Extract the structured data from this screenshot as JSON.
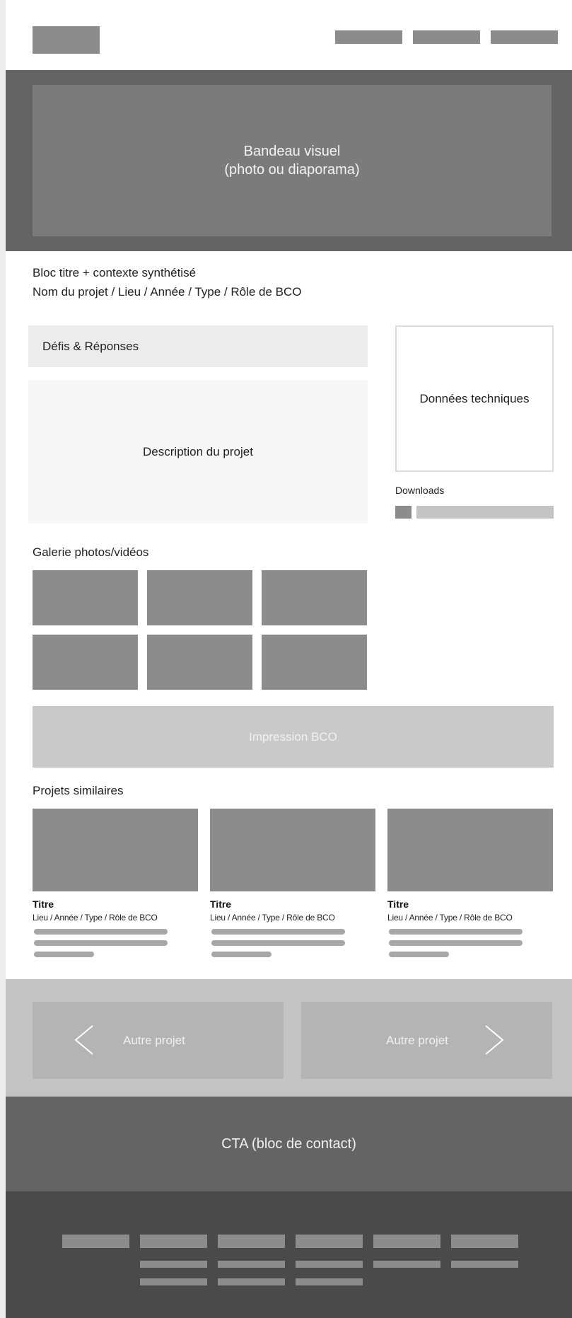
{
  "hero": {
    "line1": "Bandeau visuel",
    "line2": "(photo ou diaporama)"
  },
  "title_block": {
    "line1": "Bloc titre + contexte synthétisé",
    "line2": "Nom du projet / Lieu / Année / Type / Rôle de BCO"
  },
  "main": {
    "defis_label": "Défis & Réponses",
    "description_label": "Description du projet",
    "tech_label": "Données techniques",
    "downloads_label": "Downloads"
  },
  "gallery": {
    "label": "Galerie photos/vidéos"
  },
  "impression": {
    "label": "Impression BCO"
  },
  "similar": {
    "label": "Projets similaires",
    "items": [
      {
        "title": "Titre",
        "subtitle": "Lieu / Année / Type / Rôle de BCO"
      },
      {
        "title": "Titre",
        "subtitle": "Lieu / Année / Type / Rôle de BCO"
      },
      {
        "title": "Titre",
        "subtitle": "Lieu / Année / Type / Rôle de BCO"
      }
    ]
  },
  "project_nav": {
    "prev_label": "Autre projet",
    "next_label": "Autre projet",
    "prev_icon": "chevron-left-icon",
    "next_icon": "chevron-right-icon"
  },
  "cta": {
    "label": "CTA (bloc de contact)"
  },
  "colors": {
    "placeholder_dark": "#8c8c8c",
    "hero_band": "#646464",
    "footer": "#4a4a4a",
    "nav_band": "#c4c4c4"
  }
}
